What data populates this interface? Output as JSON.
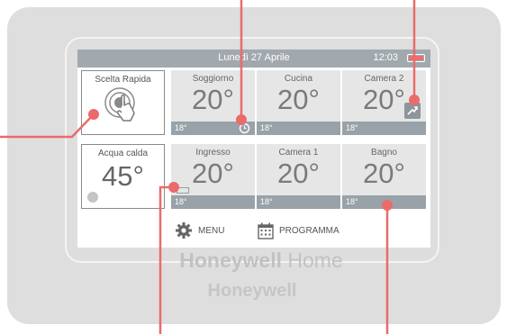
{
  "status_bar": {
    "date": "Lunedì 27 Aprile",
    "time": "12:03"
  },
  "tiles": {
    "quick": {
      "label": "Scelta Rapida"
    },
    "soggiorno": {
      "name": "Soggiorno",
      "temp": "20°",
      "setpoint": "18°"
    },
    "cucina": {
      "name": "Cucina",
      "temp": "20°",
      "setpoint": "18°"
    },
    "camera2": {
      "name": "Camera 2",
      "temp": "20°",
      "setpoint": "18°"
    },
    "acqua": {
      "name": "Acqua calda",
      "temp": "45°"
    },
    "ingresso": {
      "name": "Ingresso",
      "temp": "20°",
      "setpoint": "18°"
    },
    "camera1": {
      "name": "Camera 1",
      "temp": "20°",
      "setpoint": "18°"
    },
    "bagno": {
      "name": "Bagno",
      "temp": "20°",
      "setpoint": "18°"
    }
  },
  "bottom_menu": {
    "menu_label": "MENU",
    "programma_label": "PROGRAMMA"
  },
  "branding": {
    "logo_bold": "Honeywell",
    "logo_light": "Home",
    "logo_secondary": "Honeywell"
  },
  "icons": {
    "quick": "touch-tap-icon",
    "soggiorno": "clock-icon",
    "camera2": "boost-arrow-icon",
    "acqua": "status-dot-icon",
    "ingresso": "low-battery-icon",
    "menu": "gear-icon",
    "programma": "calendar-icon"
  },
  "colors": {
    "callout": "#EB6B6B",
    "footer": "#98A2A8",
    "tile": "#E6E6E6",
    "battery_fill": "#EA6F6F"
  }
}
